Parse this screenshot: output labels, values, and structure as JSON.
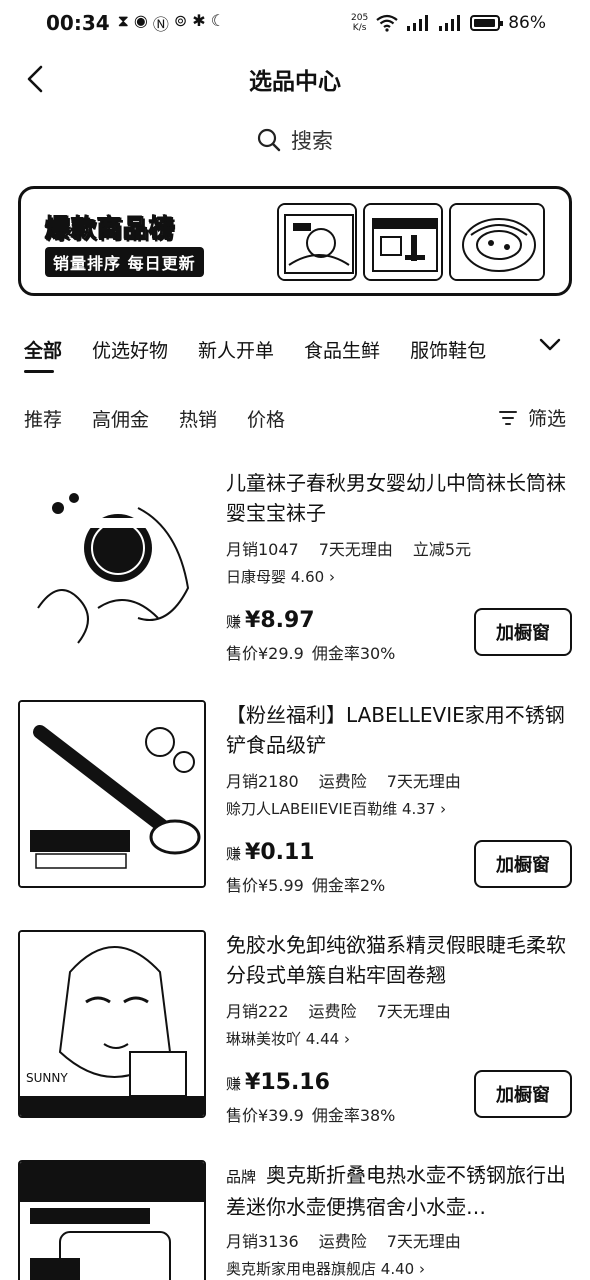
{
  "status": {
    "time": "00:34",
    "net_speed_top": "205",
    "net_speed_bottom": "K/s",
    "battery": "86%"
  },
  "header": {
    "title": "选品中心"
  },
  "search": {
    "label": "搜索"
  },
  "banner": {
    "title": "爆款商品榜",
    "subtitle": "销量排序 每日更新"
  },
  "categories": [
    "全部",
    "优选好物",
    "新人开单",
    "食品生鲜",
    "服饰鞋包"
  ],
  "sort": {
    "items": [
      "推荐",
      "高佣金",
      "热销",
      "价格"
    ],
    "filter": "筛选"
  },
  "products": [
    {
      "tag": "",
      "title": "儿童袜子春秋男女婴幼儿中筒袜长筒袜婴宝宝袜子",
      "meta": [
        "月销1047",
        "7天无理由",
        "立减5元"
      ],
      "shop": "日康母婴 4.60",
      "earn_label": "赚",
      "earn": "¥8.97",
      "price": "售价¥29.9",
      "commission": "佣金率30%",
      "button": "加橱窗"
    },
    {
      "tag": "",
      "title": "【粉丝福利】LABELLEVIE家用不锈钢铲食品级铲",
      "meta": [
        "月销2180",
        "运费险",
        "7天无理由"
      ],
      "shop": "赊刀人LABEIIEVIE百勒维 4.37",
      "earn_label": "赚",
      "earn": "¥0.11",
      "price": "售价¥5.99",
      "commission": "佣金率2%",
      "button": "加橱窗"
    },
    {
      "tag": "",
      "title": "免胶水免卸纯欲猫系精灵假眼睫毛柔软分段式单簇自粘牢固卷翘",
      "meta": [
        "月销222",
        "运费险",
        "7天无理由"
      ],
      "shop": "琳琳美妆吖 4.44",
      "earn_label": "赚",
      "earn": "¥15.16",
      "price": "售价¥39.9",
      "commission": "佣金率38%",
      "button": "加橱窗"
    },
    {
      "tag": "品牌",
      "title": "奥克斯折叠电热水壶不锈钢旅行出差迷你水壶便携宿舍小水壶…",
      "meta": [
        "月销3136",
        "运费险",
        "7天无理由"
      ],
      "shop": "奥克斯家用电器旗舰店 4.40",
      "earn_label": "",
      "earn": "",
      "price": "",
      "commission": "",
      "button": ""
    }
  ]
}
